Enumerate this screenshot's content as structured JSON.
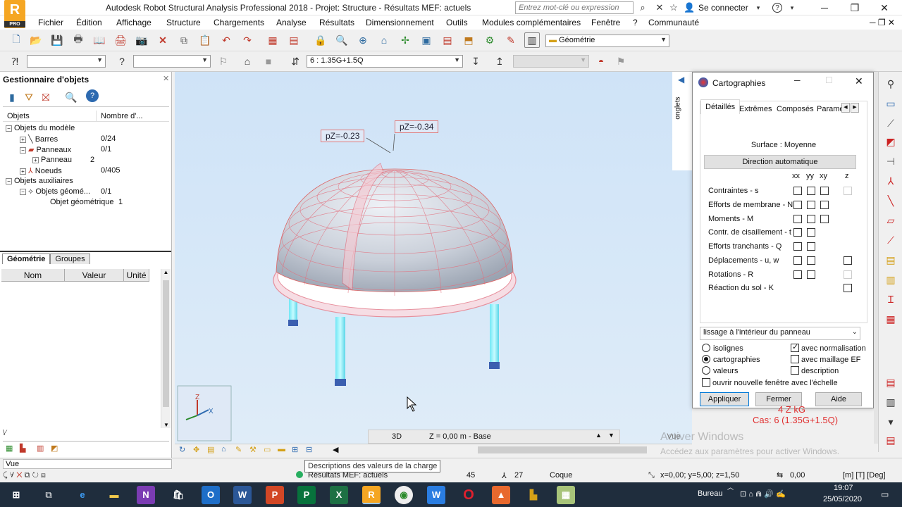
{
  "window": {
    "title": "Autodesk Robot Structural Analysis Professional 2018 - Projet: Structure - Résultats MEF: actuels",
    "logo_letter": "R",
    "logo_badge": "PRO",
    "search_placeholder": "Entrez mot-clé ou expression",
    "signin": "Se connecter"
  },
  "menu": [
    "Fichier",
    "Édition",
    "Affichage",
    "Structure",
    "Chargements",
    "Analyse",
    "Résultats",
    "Dimensionnement",
    "Outils",
    "Modules complémentaires",
    "Fenêtre",
    "?",
    "Communauté"
  ],
  "toolbar": {
    "layout_combo": "Géométrie",
    "case_combo": "6 : 1.35G+1.5Q"
  },
  "object_manager": {
    "title": "Gestionnaire d'objets",
    "columns": [
      "Objets",
      "Nombre d'..."
    ],
    "tree": [
      {
        "label": "Objets du modèle",
        "count": ""
      },
      {
        "label": "Barres",
        "count": "0/24"
      },
      {
        "label": "Panneaux",
        "count": "0/1"
      },
      {
        "label": "Panneau",
        "count": "2"
      },
      {
        "label": "Noeuds",
        "count": "0/405"
      },
      {
        "label": "Objets auxiliaires",
        "count": ""
      },
      {
        "label": "Objets géomé...",
        "count": "0/1"
      },
      {
        "label": "Objet géométrique",
        "count": "1"
      }
    ],
    "tabs": [
      "Géométrie",
      "Groupes"
    ],
    "prop_columns": [
      "Nom",
      "Valeur",
      "Unité"
    ]
  },
  "viewport": {
    "label_1": "pZ=-0.23",
    "label_2": "pZ=-0.34",
    "view_mode": "3D",
    "plane": "Z = 0,00 m - Base",
    "side_tab": "onglets",
    "result_line_1": "4 Z kG",
    "result_line_2": "Cas: 6 (1.35G+1.5Q)",
    "watermark_1": "Activer Windows",
    "watermark_2": "Accédez aux paramètres pour activer Windows.",
    "vue": "Vue"
  },
  "dialog": {
    "title": "Cartographies",
    "tabs": [
      "Détaillés",
      "Extrêmes",
      "Composés",
      "Paramè"
    ],
    "surface": "Surface : Moyenne",
    "direction_button": "Direction automatique",
    "columns": [
      "xx",
      "yy",
      "xy",
      "z"
    ],
    "rows": [
      "Contraintes - s",
      "Efforts de membrane - N",
      "Moments - M",
      "Contr. de cisaillement - t",
      "Efforts tranchants - Q",
      "Déplacements - u, w",
      "Rotations - R",
      "Réaction du sol - K"
    ],
    "smoothing": "lissage à l'intérieur du panneau",
    "radio_isolines": "isolignes",
    "radio_maps": "cartographies",
    "radio_values": "valeurs",
    "opt_normalisation": "avec normalisation",
    "opt_mesh": "avec maillage EF",
    "opt_description": "description",
    "opt_new_window": "ouvrir nouvelle fenêtre avec l'échelle",
    "btn_apply": "Appliquer",
    "btn_close": "Fermer",
    "btn_help": "Aide"
  },
  "status": {
    "vue": "Vue",
    "tooltip": "Descriptions des valeurs de la charge",
    "results": "Résultats MEF: actuels",
    "n1": "45",
    "n2": "27",
    "type": "Coque",
    "coords": "x=0,00; y=5,00; z=1,50",
    "value": "0,00",
    "units": "[m] [T] [Deg]"
  },
  "taskbar": {
    "desktop": "Bureau",
    "time": "19:07",
    "date": "25/05/2020"
  }
}
